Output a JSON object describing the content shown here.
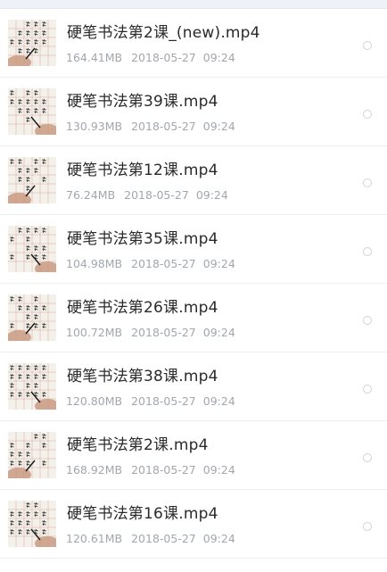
{
  "files": [
    {
      "name": "硬笔书法第2课_(new).mp4",
      "size": "164.41MB",
      "date": "2018-05-27",
      "time": "09:24",
      "thumb_icon": "video-thumbnail-icon"
    },
    {
      "name": "硬笔书法第39课.mp4",
      "size": "130.93MB",
      "date": "2018-05-27",
      "time": "09:24",
      "thumb_icon": "video-thumbnail-icon"
    },
    {
      "name": "硬笔书法第12课.mp4",
      "size": "76.24MB",
      "date": "2018-05-27",
      "time": "09:24",
      "thumb_icon": "video-thumbnail-icon"
    },
    {
      "name": "硬笔书法第35课.mp4",
      "size": "104.98MB",
      "date": "2018-05-27",
      "time": "09:24",
      "thumb_icon": "video-thumbnail-icon"
    },
    {
      "name": "硬笔书法第26课.mp4",
      "size": "100.72MB",
      "date": "2018-05-27",
      "time": "09:24",
      "thumb_icon": "video-thumbnail-icon"
    },
    {
      "name": "硬笔书法第38课.mp4",
      "size": "120.80MB",
      "date": "2018-05-27",
      "time": "09:24",
      "thumb_icon": "video-thumbnail-icon"
    },
    {
      "name": "硬笔书法第2课.mp4",
      "size": "168.92MB",
      "date": "2018-05-27",
      "time": "09:24",
      "thumb_icon": "video-thumbnail-icon"
    },
    {
      "name": "硬笔书法第16课.mp4",
      "size": "120.61MB",
      "date": "2018-05-27",
      "time": "09:24",
      "thumb_icon": "video-thumbnail-icon"
    }
  ],
  "colors": {
    "title": "#2a2a2a",
    "meta": "#a2a7ad",
    "divider": "#eceff2",
    "radio_border": "#cfd3d8",
    "thumb_paper": "#f4f1ea",
    "thumb_grid": "#d9a3a3",
    "thumb_ink": "#2b2b2b",
    "thumb_hand": "#c99a80"
  }
}
